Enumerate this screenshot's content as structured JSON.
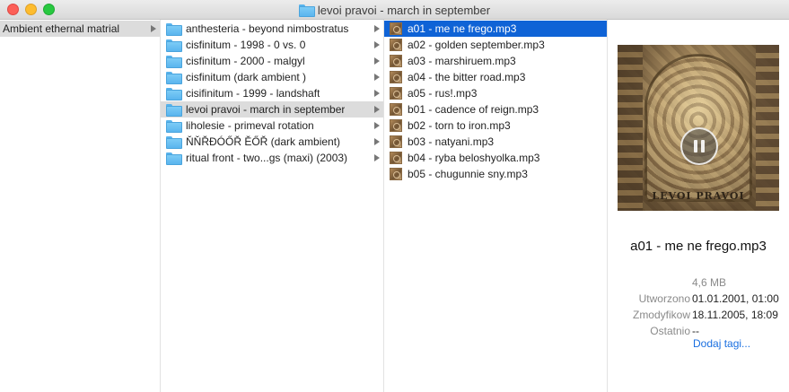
{
  "window": {
    "title": "levoi pravoi - march in september"
  },
  "column1": {
    "items": [
      {
        "label": "Ambient ethernal matrial",
        "has_children": true,
        "selected": true
      }
    ]
  },
  "column2": {
    "items": [
      {
        "label": "anthesteria - beyond nimbostratus",
        "has_children": true,
        "selected": false
      },
      {
        "label": "cisfinitum - 1998 - 0 vs. 0",
        "has_children": true,
        "selected": false
      },
      {
        "label": "cisfinitum - 2000 - malgyl",
        "has_children": true,
        "selected": false
      },
      {
        "label": "cisfinitum (dark ambient )",
        "has_children": true,
        "selected": false
      },
      {
        "label": "cisifinitum - 1999 - landshaft",
        "has_children": true,
        "selected": false
      },
      {
        "label": "levoi pravoi - march in september",
        "has_children": true,
        "selected": true
      },
      {
        "label": "liholesie - primeval rotation",
        "has_children": true,
        "selected": false
      },
      {
        "label": "ŇŇŘĐÓŐŘ ĚŐŘ (dark ambient)",
        "has_children": true,
        "selected": false
      },
      {
        "label": "ritual front - two...gs (maxi) (2003)",
        "has_children": true,
        "selected": false
      }
    ]
  },
  "column3": {
    "items": [
      {
        "label": "a01 - me ne frego.mp3",
        "selected": true
      },
      {
        "label": "a02 - golden september.mp3",
        "selected": false
      },
      {
        "label": "a03 - marshiruem.mp3",
        "selected": false
      },
      {
        "label": "a04 - the bitter road.mp3",
        "selected": false
      },
      {
        "label": "a05 - rus!.mp3",
        "selected": false
      },
      {
        "label": "b01 - cadence of reign.mp3",
        "selected": false
      },
      {
        "label": "b02 - torn to iron.mp3",
        "selected": false
      },
      {
        "label": "b03 - natyani.mp3",
        "selected": false
      },
      {
        "label": "b04 - ryba beloshyolka.mp3",
        "selected": false
      },
      {
        "label": "b05 - chugunnie sny.mp3",
        "selected": false
      }
    ]
  },
  "preview": {
    "artwork_text": "LEVOI PRAVOI",
    "file_name": "a01 - me ne frego.mp3",
    "size": "4,6 MB",
    "created_label": "Utworzono",
    "created_value": "01.01.2001, 01:00",
    "modified_label": "Zmodyfikow",
    "modified_value": "18.11.2005, 18:09",
    "last_opened_label": "Ostatnio",
    "last_opened_value": "--",
    "add_tags_label": "Dodaj tagi..."
  },
  "colors": {
    "selection_blue": "#0f63d6",
    "selection_gray": "#dcdcdc",
    "folder_blue": "#5ab5ee",
    "link_blue": "#1a6fe0"
  }
}
